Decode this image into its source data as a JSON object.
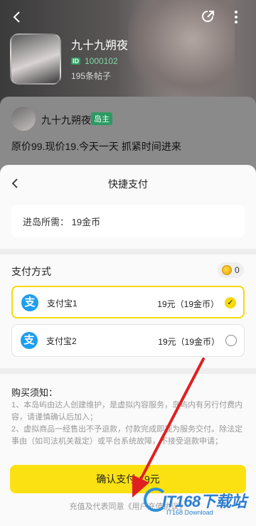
{
  "profile": {
    "name": "九十九朔夜",
    "id_badge": "ID",
    "id": "1000102",
    "posts": "195条帖子"
  },
  "post": {
    "author": "九十九朔夜",
    "owner_badge": "岛主",
    "text": "原价99.现价19.今天一天 抓紧时间进来"
  },
  "sheet": {
    "title": "快捷支付",
    "fee_label": "进岛所需：",
    "fee_value": "19金币",
    "payment_title": "支付方式",
    "coin_balance": "0",
    "options": [
      {
        "icon": "支",
        "name": "支付宝1",
        "price": "19元（19金币）",
        "selected": true
      },
      {
        "icon": "支",
        "name": "支付宝2",
        "price": "19元（19金币）",
        "selected": false
      }
    ],
    "notice_title": "购买须知：",
    "notice_lines": [
      "1、本岛屿由达人创建维护，是虚拟内容服务，岛屿内有另行付费内容，请谨慎确认后加入；",
      "2、虚拟商品一经售出不予退款，付款完成即视为服务交付。除法定事由（如司法机关裁定）或平台系统故障，不接受退款申请；"
    ],
    "confirm_label": "确认支付 19元",
    "footer_note": "充值及代表同意《用户充值协议》"
  },
  "watermark": {
    "main": "IT168下载站",
    "sub": "IT168 Download"
  },
  "colors": {
    "accent_yellow": "#fbe112",
    "alipay_blue": "#1e9ef0",
    "owner_green": "#2c9a62",
    "annotation_red": "#e02020"
  }
}
